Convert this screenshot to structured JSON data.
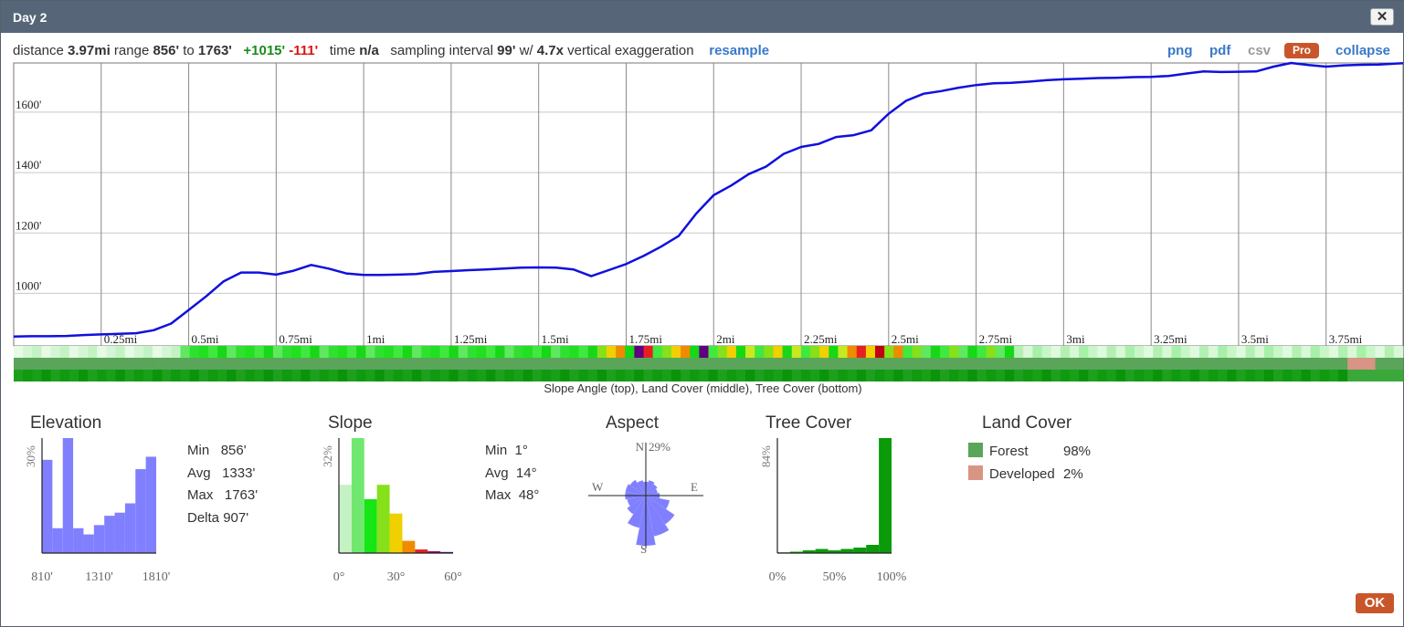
{
  "dialog": {
    "title": "Day 2",
    "close_label": "✕",
    "ok_label": "OK"
  },
  "stats_bar": {
    "distance_label": "distance",
    "distance": "3.97mi",
    "range_label": "range",
    "range_min": "856'",
    "to_label": "to",
    "range_max": "1763'",
    "gain": "+1015'",
    "loss": "-111'",
    "time_label": "time",
    "time": "n/a",
    "sampling_label": "sampling interval",
    "sampling": "99'",
    "with_label": "w/",
    "exaggeration": "4.7x",
    "exaggeration_label": "vertical exaggeration",
    "resample_label": "resample"
  },
  "links": {
    "png": "png",
    "pdf": "pdf",
    "csv": "csv",
    "pro": "Pro",
    "collapse": "collapse"
  },
  "colors": {
    "profile_line": "#1010dd",
    "histogram_bar": "#8080ff",
    "forest": "#5aa55a",
    "developed": "#d89484",
    "tree_cover_bar": "#0a9a0a",
    "accent_button": "#c9562b",
    "link": "#3b78c8"
  },
  "strips": {
    "caption": "Slope Angle (top), Land Cover (middle), Tree Cover (bottom)"
  },
  "chart_data": [
    {
      "type": "line",
      "xlabel": "",
      "ylabel": "",
      "xlim": [
        0,
        3.97
      ],
      "ylim": [
        826,
        1763
      ],
      "x_ticks": [
        0.25,
        0.5,
        0.75,
        1,
        1.25,
        1.5,
        1.75,
        2,
        2.25,
        2.5,
        2.75,
        3,
        3.25,
        3.5,
        3.75
      ],
      "x_tick_labels": [
        "0.25mi",
        "0.5mi",
        "0.75mi",
        "1mi",
        "1.25mi",
        "1.5mi",
        "1.75mi",
        "2mi",
        "2.25mi",
        "2.5mi",
        "2.75mi",
        "3mi",
        "3.25mi",
        "3.5mi",
        "3.75mi"
      ],
      "y_ticks": [
        1000,
        1200,
        1400,
        1600
      ],
      "y_tick_labels": [
        "1000'",
        "1200'",
        "1400'",
        "1600'"
      ],
      "grid": true,
      "series": [
        {
          "x": [
            0,
            0.05,
            0.1,
            0.15,
            0.2,
            0.25,
            0.3,
            0.35,
            0.4,
            0.45,
            0.5,
            0.55,
            0.6,
            0.65,
            0.7,
            0.75,
            0.8,
            0.85,
            0.9,
            0.95,
            1,
            1.05,
            1.1,
            1.15,
            1.2,
            1.25,
            1.3,
            1.35,
            1.4,
            1.45,
            1.5,
            1.55,
            1.6,
            1.65,
            1.7,
            1.75,
            1.8,
            1.85,
            1.9,
            1.95,
            2,
            2.05,
            2.1,
            2.15,
            2.2,
            2.25,
            2.3,
            2.35,
            2.4,
            2.45,
            2.5,
            2.55,
            2.6,
            2.65,
            2.7,
            2.75,
            2.8,
            2.85,
            2.9,
            2.95,
            3,
            3.05,
            3.1,
            3.15,
            3.2,
            3.25,
            3.3,
            3.35,
            3.4,
            3.45,
            3.5,
            3.55,
            3.6,
            3.65,
            3.7,
            3.75,
            3.8,
            3.85,
            3.9,
            3.97
          ],
          "y": [
            857,
            858,
            858,
            859,
            862,
            864,
            866,
            868,
            878,
            900,
            945,
            990,
            1040,
            1069,
            1069,
            1062,
            1075,
            1094,
            1082,
            1066,
            1061,
            1061,
            1062,
            1064,
            1071,
            1074,
            1077,
            1079,
            1082,
            1085,
            1086,
            1085,
            1079,
            1057,
            1077,
            1097,
            1124,
            1155,
            1190,
            1264,
            1325,
            1357,
            1395,
            1420,
            1462,
            1485,
            1495,
            1518,
            1524,
            1540,
            1595,
            1638,
            1661,
            1670,
            1681,
            1690,
            1696,
            1697,
            1701,
            1706,
            1709,
            1711,
            1713,
            1714,
            1716,
            1717,
            1720,
            1728,
            1735,
            1733,
            1734,
            1735,
            1751,
            1763,
            1756,
            1751,
            1755,
            1757,
            1758,
            1762
          ]
        }
      ]
    },
    {
      "type": "bar",
      "title": "Elevation",
      "y_max_label": "30%",
      "x_tick_labels": [
        "810'",
        "1310'",
        "1810'"
      ],
      "values": [
        30,
        8,
        37,
        8,
        6,
        9,
        12,
        13,
        16,
        27,
        31
      ],
      "stats": [
        {
          "label": "Min",
          "value": "856'"
        },
        {
          "label": "Avg",
          "value": "1333'"
        },
        {
          "label": "Max",
          "value": "1763'"
        },
        {
          "label": "Delta",
          "value": "907'"
        }
      ]
    },
    {
      "type": "bar",
      "title": "Slope",
      "y_max_label": "32%",
      "x_tick_labels": [
        "0°",
        "30°",
        "60°"
      ],
      "values": [
        19,
        32,
        15,
        19,
        11,
        3.4,
        1,
        0.5,
        0.3
      ],
      "colors": [
        "#c4f2c4",
        "#70e870",
        "#16e516",
        "#86e01a",
        "#f0d000",
        "#f08a00",
        "#e62020",
        "#a00060",
        "#500080"
      ],
      "stats": [
        {
          "label": "Min",
          "value": "1°"
        },
        {
          "label": "Avg",
          "value": "14°"
        },
        {
          "label": "Max",
          "value": "48°"
        }
      ]
    },
    {
      "type": "pie",
      "title": "Aspect",
      "max_label": "29%",
      "direction_labels": {
        "n": "N",
        "e": "E",
        "s": "S",
        "w": "W"
      },
      "directions": [
        "N",
        "NNE",
        "NE",
        "ENE",
        "E",
        "ESE",
        "SE",
        "SSE",
        "S",
        "SSW",
        "SW",
        "WSW",
        "W",
        "WNW",
        "NW",
        "NNW"
      ],
      "values": [
        8,
        9,
        8,
        7,
        8,
        14,
        20,
        24,
        29,
        19,
        13,
        11,
        12,
        12,
        11,
        9
      ]
    },
    {
      "type": "bar",
      "title": "Tree Cover",
      "y_max_label": "84%",
      "x_tick_labels": [
        "0%",
        "50%",
        "100%"
      ],
      "values": [
        0.5,
        1,
        2,
        3,
        2,
        3,
        4,
        6,
        84
      ]
    },
    {
      "type": "table",
      "title": "Land Cover",
      "rows": [
        {
          "label": "Forest",
          "value": "98%",
          "color": "#5aa55a"
        },
        {
          "label": "Developed",
          "value": "2%",
          "color": "#d89484"
        }
      ]
    }
  ]
}
